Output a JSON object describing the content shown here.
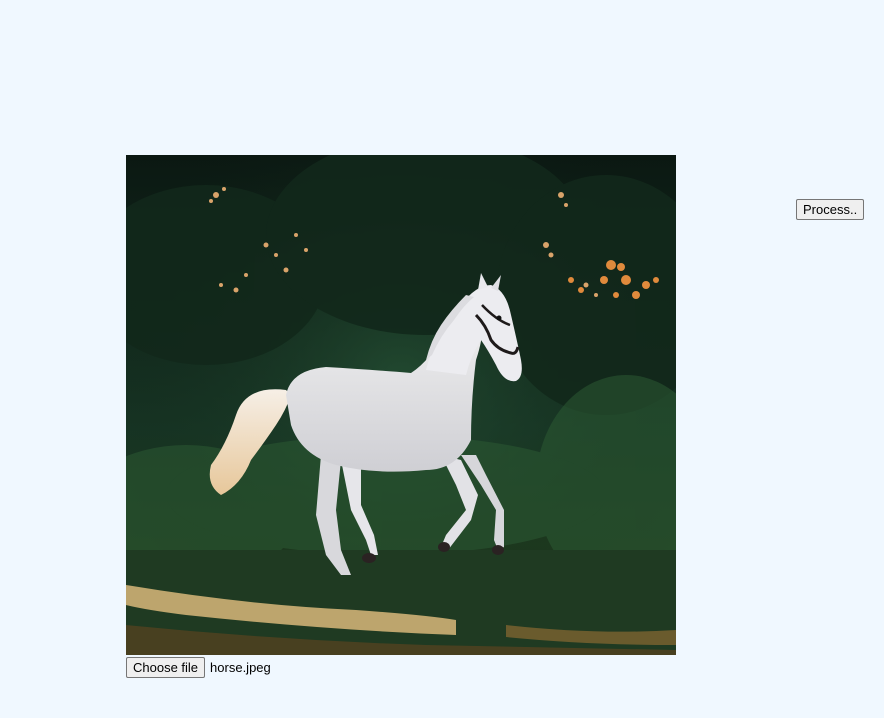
{
  "upload": {
    "choose_label": "Choose file",
    "file_name": "horse.jpeg"
  },
  "actions": {
    "process_label": "Process.."
  },
  "preview": {
    "alt": "horse.jpeg",
    "icon": "photo-white-horse"
  },
  "colors": {
    "page_background": "#f0f8ff",
    "button_background": "#efefef",
    "button_border": "#767676"
  }
}
